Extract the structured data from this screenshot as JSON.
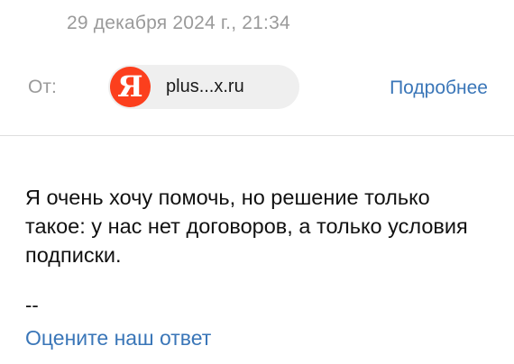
{
  "header": {
    "date": "29 декабря 2024 г., 21:34"
  },
  "sender": {
    "from_label": "От:",
    "avatar_letter": "Я",
    "avatar_color": "#fc3f1d",
    "address": "plus...x.ru",
    "details_link": "Подробнее"
  },
  "message": {
    "body": "Я очень хочу помочь, но решение только такое: у нас нет договоров, а только условия подписки.",
    "signature_separator": "--",
    "rate_link": "Оцените наш ответ"
  },
  "colors": {
    "link": "#3a76b8",
    "muted": "#9a9a9a"
  }
}
